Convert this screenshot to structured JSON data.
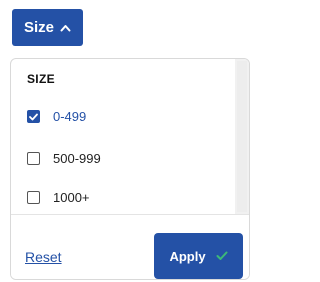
{
  "toggle": {
    "label": "Size",
    "icon": "chevron-up-icon"
  },
  "panel": {
    "section_title": "SIZE",
    "options": [
      {
        "label": "0-499",
        "checked": true
      },
      {
        "label": "500-999",
        "checked": false
      },
      {
        "label": "1000+",
        "checked": false
      }
    ]
  },
  "footer": {
    "reset_label": "Reset",
    "apply_label": "Apply",
    "apply_icon": "check-icon"
  },
  "colors": {
    "accent": "#2451a6",
    "check_green": "#3cb878"
  }
}
